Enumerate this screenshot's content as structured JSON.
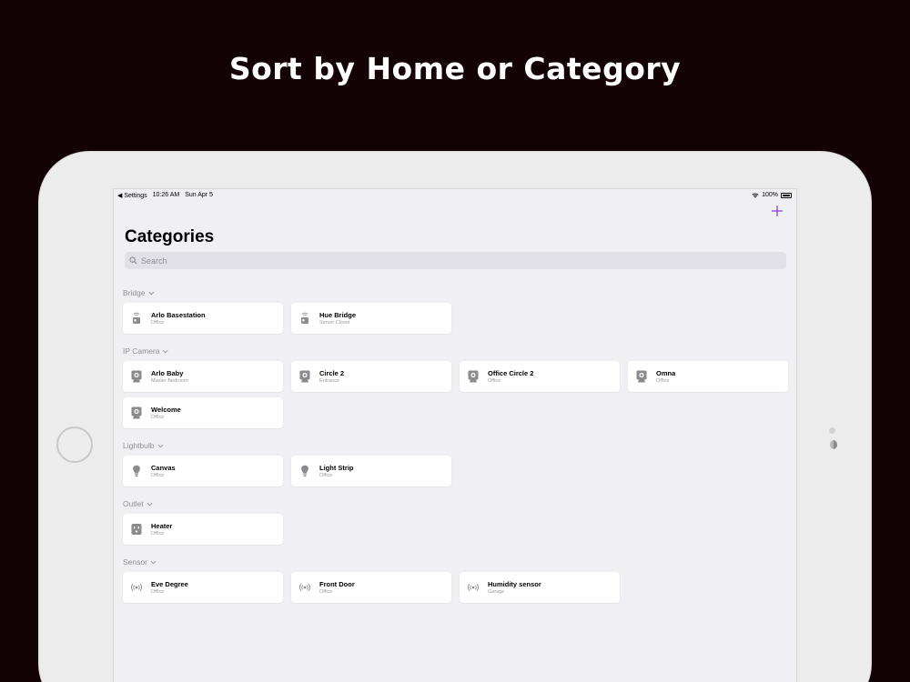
{
  "headline": "Sort by Home or Category",
  "status_bar": {
    "back_label": "◀ Settings",
    "time": "10:26 AM",
    "date": "Sun Apr 5",
    "battery": "100%"
  },
  "accent_color": "#8e44e8",
  "page_title": "Categories",
  "search": {
    "placeholder": "Search",
    "value": ""
  },
  "sections": [
    {
      "title": "Bridge",
      "icon": "bridge-icon",
      "items": [
        {
          "name": "Arlo Basestation",
          "room": "Office"
        },
        {
          "name": "Hue Bridge",
          "room": "Server Closet"
        }
      ]
    },
    {
      "title": "IP Camera",
      "icon": "camera-icon",
      "items": [
        {
          "name": "Arlo Baby",
          "room": "Master Bedroom"
        },
        {
          "name": "Circle 2",
          "room": "Entrance"
        },
        {
          "name": "Office Circle 2",
          "room": "Office"
        },
        {
          "name": "Omna",
          "room": "Office"
        },
        {
          "name": "Welcome",
          "room": "Office"
        }
      ]
    },
    {
      "title": "Lightbulb",
      "icon": "lightbulb-icon",
      "items": [
        {
          "name": "Canvas",
          "room": "Office"
        },
        {
          "name": "Light Strip",
          "room": "Office"
        }
      ]
    },
    {
      "title": "Outlet",
      "icon": "outlet-icon",
      "items": [
        {
          "name": "Heater",
          "room": "Office"
        }
      ]
    },
    {
      "title": "Sensor",
      "icon": "sensor-icon",
      "items": [
        {
          "name": "Eve Degree",
          "room": "Office"
        },
        {
          "name": "Front Door",
          "room": "Office"
        },
        {
          "name": "Humidity sensor",
          "room": "Garage"
        }
      ]
    }
  ]
}
